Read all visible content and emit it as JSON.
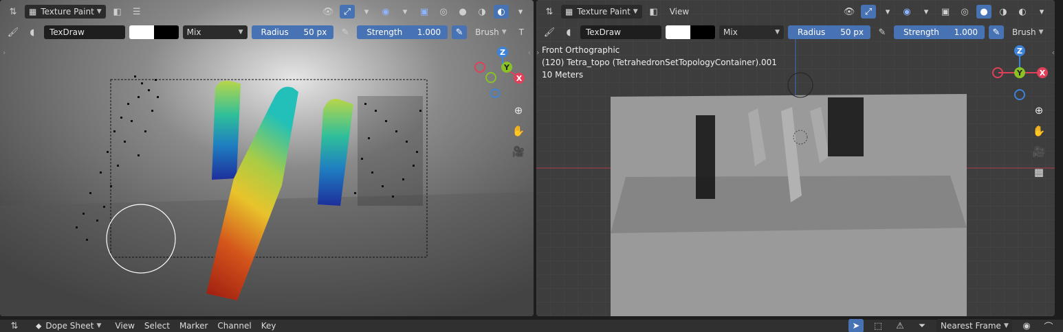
{
  "left_viewport": {
    "mode": "Texture Paint",
    "brush_name": "TexDraw",
    "blend": "Mix",
    "radius_label": "Radius",
    "radius_value": "50 px",
    "strength_label": "Strength",
    "strength_value": "1.000",
    "brush_menu": "Brush",
    "trunc_menu": "T"
  },
  "right_viewport": {
    "mode": "Texture Paint",
    "view_menu": "View",
    "brush_name": "TexDraw",
    "blend": "Mix",
    "radius_label": "Radius",
    "radius_value": "50 px",
    "strength_label": "Strength",
    "strength_value": "1.000",
    "brush_menu": "Brush",
    "overlay": {
      "line1": "Front Orthographic",
      "line2": "(120) Tetra_topo (TetrahedronSetTopologyContainer).001",
      "line3": "10 Meters"
    }
  },
  "gizmo": {
    "x": "X",
    "y": "Y",
    "z": "Z"
  },
  "dopesheet": {
    "editor": "Dope Sheet",
    "menus": [
      "View",
      "Select",
      "Marker",
      "Channel",
      "Key"
    ],
    "snap": "Nearest Frame"
  },
  "colors": {
    "accent": "#4772b3",
    "x_axis": "#e0405a",
    "y_axis": "#8ac226",
    "z_axis": "#3d83d9"
  }
}
